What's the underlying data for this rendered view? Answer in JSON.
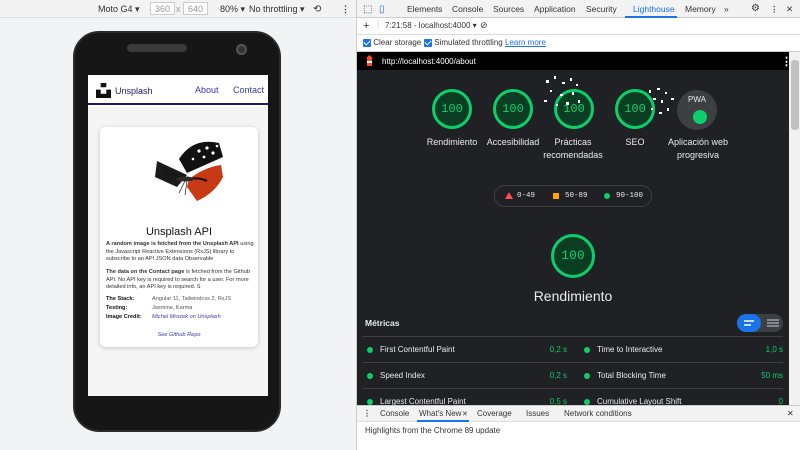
{
  "device_toolbar": {
    "device": "Moto G4",
    "width": "360",
    "times": "x",
    "height": "640",
    "zoom": "80%",
    "throttling": "No throttling"
  },
  "app": {
    "brand": "Unsplash",
    "nav": [
      "About",
      "Contact"
    ],
    "card": {
      "title": "Unsplash API",
      "para1_bold": "A random image is fetched from the Unsplash API",
      "para1": "using the Javascript Reactive Extensions (RxJS) library to subscribe to an API JSON data Observable",
      "para2_bold": "The data on the Contact page",
      "para2": "is fetched from the Github API. No API key is required to search for a user. For more detailed info, an API key is required. S",
      "rows": [
        {
          "key": "The Stack:",
          "value": "Angular 11, Tailwindcss 2, RxJS"
        },
        {
          "key": "Testing:",
          "value": "Jasmine, Karma"
        },
        {
          "key": "Image Credit:",
          "value": "Michel Mrozek on Unsplash"
        }
      ],
      "github_link": "See Github Repo"
    }
  },
  "devtools": {
    "tabs": [
      "Elements",
      "Console",
      "Sources",
      "Application",
      "Security",
      "Lighthouse",
      "Memory"
    ],
    "active_tab": "Lighthouse",
    "report_selector": "7:21:58 - localhost:4000",
    "clear_storage": "Clear storage",
    "throttling": "Simulated throttling",
    "learn_more": "Learn more",
    "report_url": "http://localhost:4000/about",
    "categories": [
      {
        "score": "100",
        "label": "Rendimiento"
      },
      {
        "score": "100",
        "label": "Accesibilidad"
      },
      {
        "score": "100",
        "label": "Prácticas recomendadas"
      },
      {
        "score": "100",
        "label": "SEO"
      }
    ],
    "pwa": {
      "text": "PWA",
      "label": "Aplicación web progresiva"
    },
    "legend": [
      {
        "range": "0-49",
        "color": "#ff4e42"
      },
      {
        "range": "50-89",
        "color": "#ffa400"
      },
      {
        "range": "90-100",
        "color": "#0cce6b"
      }
    ],
    "perf_score": "100",
    "perf_label": "Rendimiento",
    "metrics_title": "Métricas",
    "metrics": [
      {
        "label": "First Contentful Paint",
        "value": "0,2 s"
      },
      {
        "label": "Time to Interactive",
        "value": "1,0 s"
      },
      {
        "label": "Speed Index",
        "value": "0,2 s"
      },
      {
        "label": "Total Blocking Time",
        "value": "50 ms"
      },
      {
        "label": "Largest Contentful Paint",
        "value": "0,5 s"
      },
      {
        "label": "Cumulative Layout Shift",
        "value": "0"
      }
    ],
    "drawer_tabs": [
      "Console",
      "What's New",
      "Coverage",
      "Issues",
      "Network conditions"
    ],
    "drawer_message": "Highlights from the Chrome 89 update"
  }
}
